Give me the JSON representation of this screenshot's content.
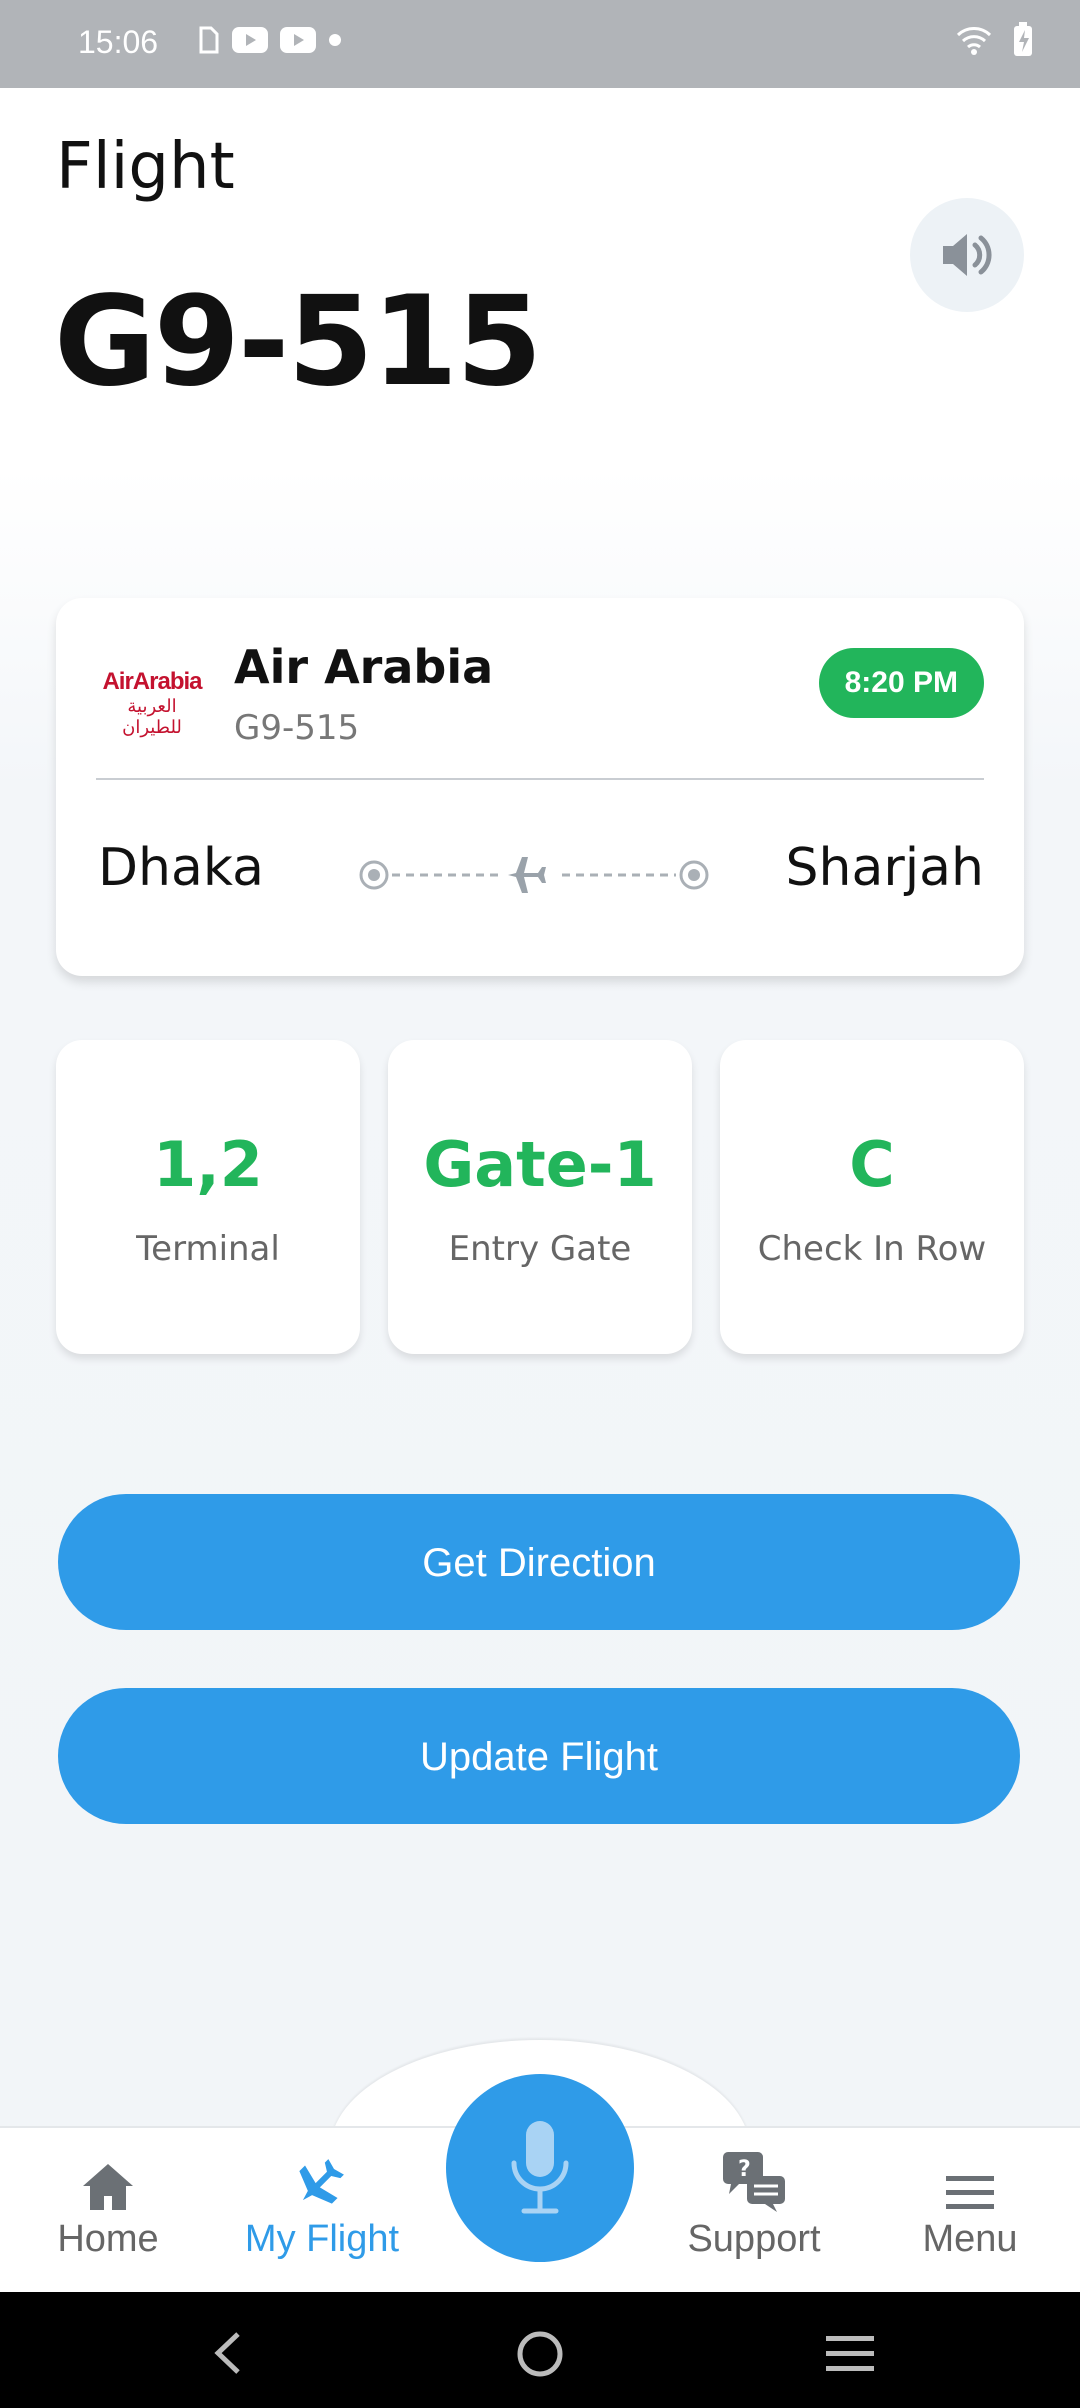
{
  "status_bar": {
    "time": "15:06"
  },
  "header": {
    "title": "Flight",
    "flight_number": "G9-515"
  },
  "flight_card": {
    "logo_en": "AirArabia",
    "logo_ar": "العربية للطيران",
    "airline": "Air Arabia",
    "code": "G9-515",
    "departure_time": "8:20 PM",
    "from": "Dhaka",
    "to": "Sharjah"
  },
  "info": [
    {
      "value": "1,2",
      "label": "Terminal"
    },
    {
      "value": "Gate-1",
      "label": "Entry Gate"
    },
    {
      "value": "C",
      "label": "Check In Row"
    }
  ],
  "actions": {
    "direction": "Get Direction",
    "update": "Update Flight"
  },
  "nav": {
    "home": "Home",
    "my_flight": "My Flight",
    "support": "Support",
    "menu": "Menu"
  },
  "colors": {
    "accent": "#2f9be8",
    "success": "#22b55b",
    "brand_red": "#c4122f"
  }
}
